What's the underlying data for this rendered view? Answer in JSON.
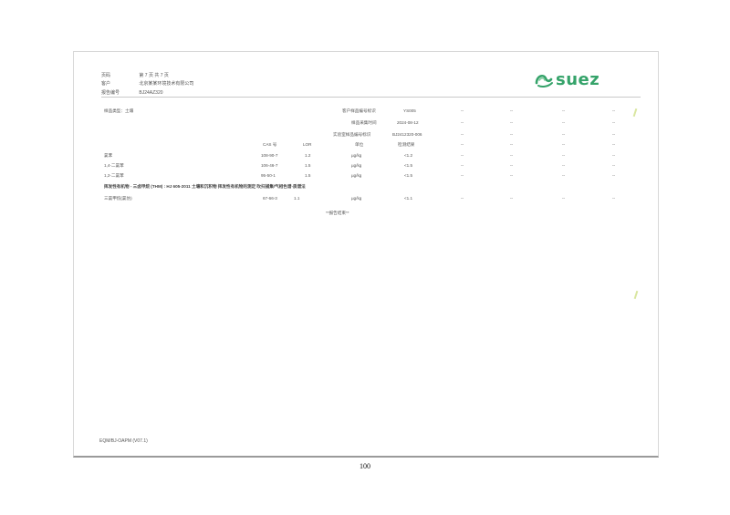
{
  "header": {
    "page_label": "页码",
    "page_value": "第 7 页  共 7 页",
    "client_label": "客户",
    "client_value": "北京某某环境技术有限公司",
    "report_label": "报告编号",
    "report_value": "BJ24AZ320"
  },
  "brand": {
    "name": "suez",
    "color": "#35a36a"
  },
  "sample": {
    "type_label": "样品类型：土壤",
    "client_id_label": "客户样品编号标识",
    "client_id_value": "YS005",
    "date_label": "样品采集时间",
    "date_value": "2024-08-12",
    "lab_id_label": "实验室样品编号标识",
    "lab_id_value": "BJ2412320-006",
    "placeholder": "--"
  },
  "columns": {
    "cas": "CAS 号",
    "lor": "LOR",
    "unit": "单位",
    "result": "检测结果"
  },
  "rows": [
    {
      "name": "氯苯",
      "cas": "108-90-7",
      "lor": "1.2",
      "unit": "µg/kg",
      "result": "<1.2"
    },
    {
      "name": "1,4-二氯苯",
      "cas": "106-46-7",
      "lor": "1.5",
      "unit": "µg/kg",
      "result": "<1.5"
    },
    {
      "name": "1,2-二氯苯",
      "cas": "95-50-1",
      "lor": "1.5",
      "unit": "µg/kg",
      "result": "<1.5"
    }
  ],
  "section2_title": "挥发性有机物 - 三卤甲烷 (THM) : HJ 605-2011 土壤和沉积物 挥发性有机物的测定 吹扫捕集/气相色谱-质谱法",
  "rows2": [
    {
      "name": "三氯甲烷(氯仿)",
      "cas": "67-66-3",
      "lor": "1.1",
      "unit": "µg/kg",
      "result": "<1.1"
    }
  ],
  "end_note": "**报告结束**",
  "footer_code": "EQM/BJ-OAPM (V07.1)",
  "page_number": "100"
}
